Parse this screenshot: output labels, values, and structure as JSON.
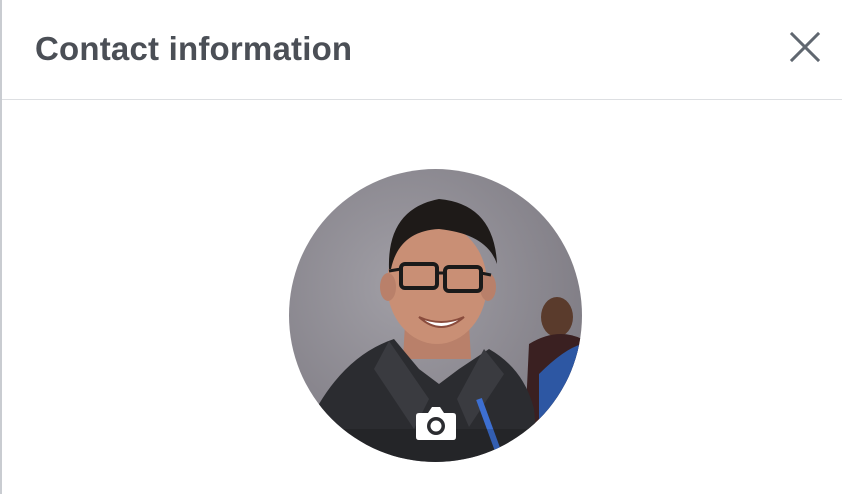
{
  "dialog": {
    "title": "Contact information",
    "close_icon": "close-icon"
  },
  "profile_photo": {
    "edit_icon": "camera-icon",
    "colors": {
      "background": "#8a8790",
      "jacket": "#2b2c30",
      "skin": "#c98f75",
      "hair": "#1e1a18"
    }
  },
  "colors": {
    "title": "#4b4f56",
    "divider": "#dddfe2",
    "close": "#606770"
  }
}
